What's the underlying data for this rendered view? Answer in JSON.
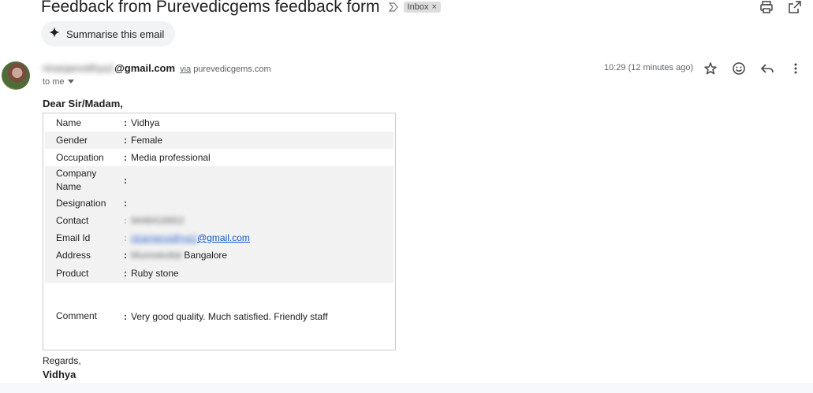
{
  "email": {
    "subject": "Feedback from Purevedicgems feedback form",
    "label": "Inbox",
    "summarise_label": "Summarise this email",
    "sender_local": "niranjanvidhya1",
    "sender_domain": "@gmail.com",
    "via_label": "via",
    "via_domain": "purevedicgems.com",
    "to_label": "to me",
    "time": "10:29 (12 minutes ago)"
  },
  "body": {
    "greeting": "Dear Sir/Madam,",
    "fields": [
      {
        "label": "Name",
        "value": "Vidhya"
      },
      {
        "label": "Gender",
        "value": "Female"
      },
      {
        "label": "Occupation",
        "value": "Media professional"
      },
      {
        "label": "Company Name",
        "value": ""
      },
      {
        "label": "Designation",
        "value": ""
      },
      {
        "label": "Contact",
        "value": "9448416653"
      },
      {
        "label": "Email Id",
        "value_local": "niranjanvidhya1",
        "value_domain": "@gmail.com"
      },
      {
        "label": "Address",
        "value_blurred": "Munnekollal",
        "value": "Bangalore"
      },
      {
        "label": "Product",
        "value": "Ruby stone"
      },
      {
        "label": "Comment",
        "value": "Very good quality. Much satisfied. Friendly staff"
      }
    ],
    "colon": ":",
    "regards": "Regards,",
    "signature": "Vidhya"
  },
  "icons": {
    "print": "print-icon",
    "open_new": "open-in-new-window-icon",
    "sparkle": "sparkle-icon",
    "star": "star-icon",
    "emoji": "emoji-icon",
    "reply": "reply-icon",
    "more": "more-vertical-icon"
  }
}
